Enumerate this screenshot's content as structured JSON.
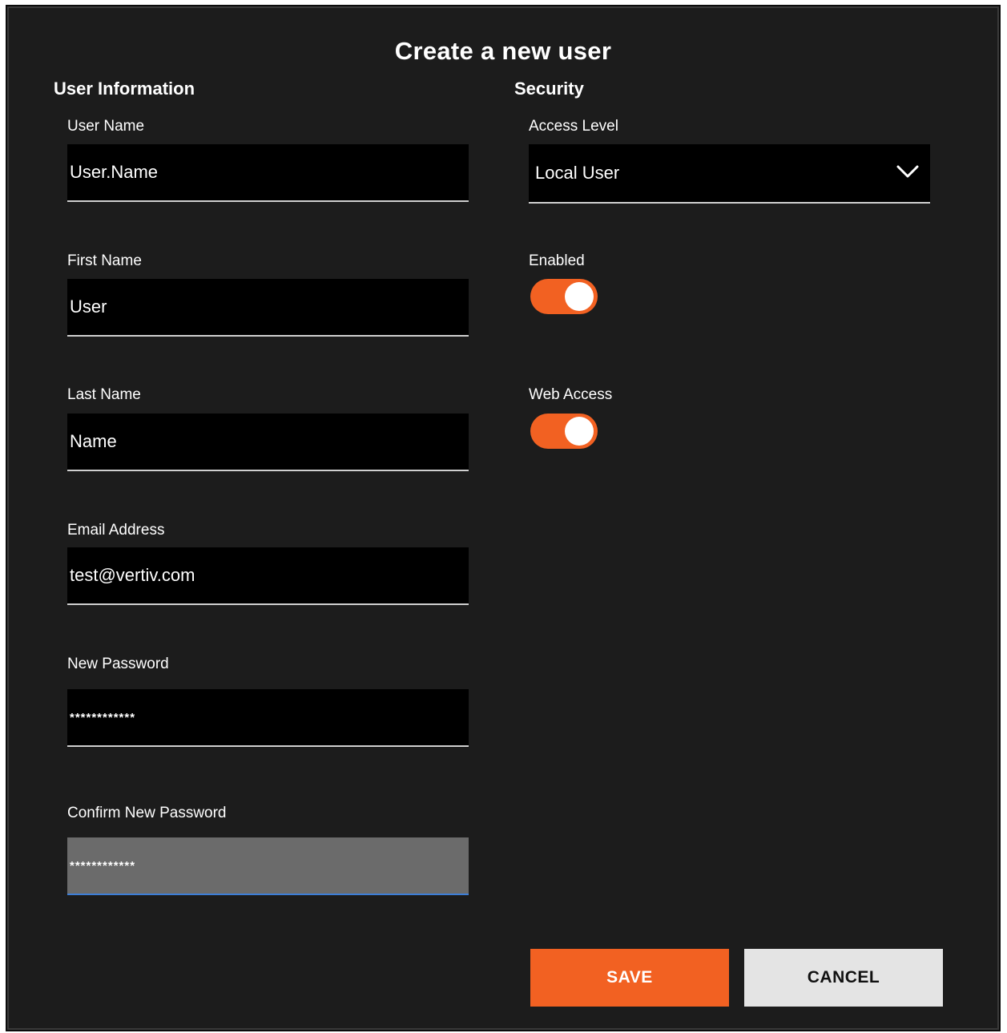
{
  "dialog": {
    "title": "Create a new user"
  },
  "user_info": {
    "section_title": "User Information",
    "user_name": {
      "label": "User Name",
      "value": "User.Name"
    },
    "first_name": {
      "label": "First Name",
      "value": "User"
    },
    "last_name": {
      "label": "Last Name",
      "value": "Name"
    },
    "email": {
      "label": "Email Address",
      "value": "test@vertiv.com"
    },
    "new_password": {
      "label": "New Password",
      "value": "************"
    },
    "confirm_password": {
      "label": "Confirm New Password",
      "value": "************"
    }
  },
  "security": {
    "section_title": "Security",
    "access_level": {
      "label": "Access Level",
      "value": "Local User",
      "icon": "chevron-down-icon"
    },
    "enabled": {
      "label": "Enabled",
      "on": true
    },
    "web_access": {
      "label": "Web Access",
      "on": true
    }
  },
  "buttons": {
    "save": "SAVE",
    "cancel": "CANCEL"
  },
  "colors": {
    "accent": "#f26122",
    "background": "#1c1c1c",
    "input_background": "#000000",
    "focused_input": "#6b6b6b",
    "cancel_button": "#e4e4e4"
  }
}
